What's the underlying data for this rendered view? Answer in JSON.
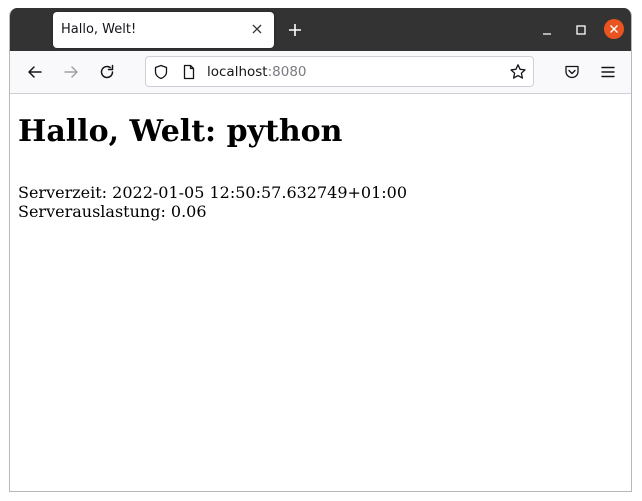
{
  "tab": {
    "title": "Hallo, Welt!"
  },
  "urlbar": {
    "host": "localhost",
    "port": ":8080"
  },
  "page": {
    "heading": "Hallo, Welt: python",
    "server_time": "Serverzeit: 2022-01-05 12:50:57.632749+01:00",
    "server_load": "Serverauslastung: 0.06"
  },
  "icons": {
    "tab_close": "close-icon",
    "new_tab": "plus-icon",
    "minimize": "minimize-icon",
    "maximize": "maximize-icon",
    "close_window": "close-window-icon",
    "back": "arrow-left-icon",
    "forward": "arrow-right-icon",
    "reload": "reload-icon",
    "tracking_protection": "shield-icon",
    "page_info": "page-icon",
    "bookmark": "star-icon",
    "pocket": "pocket-icon",
    "menu": "hamburger-menu-icon"
  },
  "colors": {
    "titlebar": "#333333",
    "close_window_button": "#e95420",
    "toolbar": "#f9f9fb"
  }
}
